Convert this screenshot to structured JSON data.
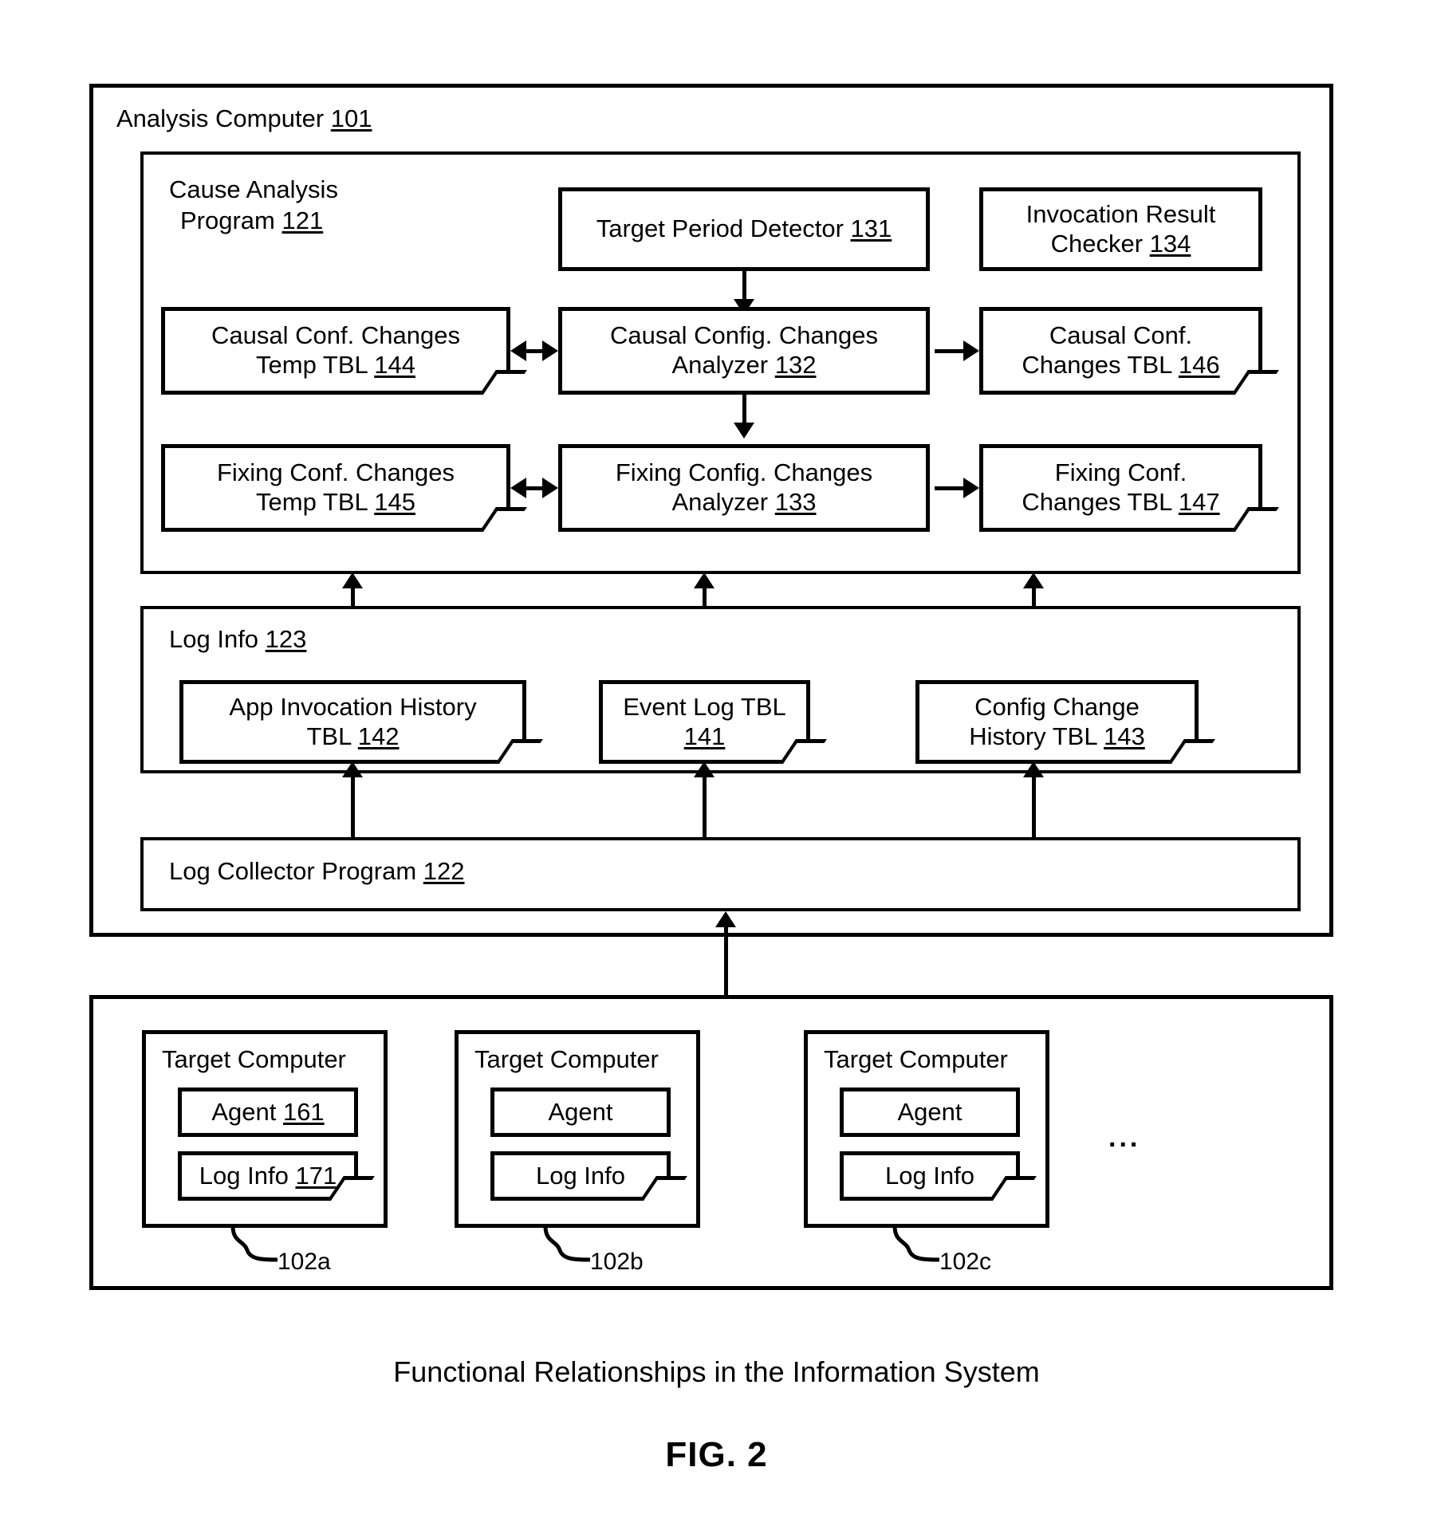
{
  "figure": {
    "caption": "Functional Relationships in the Information System",
    "number": "FIG. 2"
  },
  "analysis_computer": {
    "title": "Analysis Computer",
    "ref": "101"
  },
  "cause_analysis_program": {
    "title_line1": "Cause Analysis",
    "title_line2": "Program",
    "ref": "121",
    "boxes": {
      "target_period_detector": {
        "line1": "Target Period Detector",
        "ref": "131"
      },
      "invocation_result_checker": {
        "line1": "Invocation Result",
        "line2": "Checker",
        "ref": "134"
      },
      "causal_conf_changes_temp_tbl": {
        "line1": "Causal Conf. Changes",
        "line2": "Temp TBL",
        "ref": "144"
      },
      "causal_config_changes_analyzer": {
        "line1": "Causal Config. Changes",
        "line2": "Analyzer",
        "ref": "132"
      },
      "causal_conf_changes_tbl": {
        "line1": "Causal Conf.",
        "line2": "Changes TBL",
        "ref": "146"
      },
      "fixing_conf_changes_temp_tbl": {
        "line1": "Fixing Conf. Changes",
        "line2": "Temp TBL",
        "ref": "145"
      },
      "fixing_config_changes_analyzer": {
        "line1": "Fixing Config. Changes",
        "line2": "Analyzer",
        "ref": "133"
      },
      "fixing_conf_changes_tbl": {
        "line1": "Fixing Conf.",
        "line2": "Changes TBL",
        "ref": "147"
      }
    }
  },
  "log_info_section": {
    "title": "Log Info",
    "ref": "123",
    "boxes": {
      "app_invocation_history_tbl": {
        "line1": "App Invocation History",
        "line2": "TBL",
        "ref": "142"
      },
      "event_log_tbl": {
        "line1": "Event Log TBL",
        "line2": "",
        "ref": "141"
      },
      "config_change_history_tbl": {
        "line1": "Config Change",
        "line2": "History TBL",
        "ref": "143"
      }
    }
  },
  "log_collector_program": {
    "title": "Log Collector Program",
    "ref": "122"
  },
  "target_computers": [
    {
      "title": "Target Computer",
      "agent_label": "Agent",
      "agent_ref": "161",
      "log_info_label": "Log Info",
      "log_info_ref": "171",
      "callout_ref": "102a"
    },
    {
      "title": "Target Computer",
      "agent_label": "Agent",
      "agent_ref": "",
      "log_info_label": "Log Info",
      "log_info_ref": "",
      "callout_ref": "102b"
    },
    {
      "title": "Target Computer",
      "agent_label": "Agent",
      "agent_ref": "",
      "log_info_label": "Log Info",
      "log_info_ref": "",
      "callout_ref": "102c"
    }
  ],
  "ellipsis": "...",
  "colors": {
    "stroke": "#000000",
    "background": "#ffffff"
  }
}
